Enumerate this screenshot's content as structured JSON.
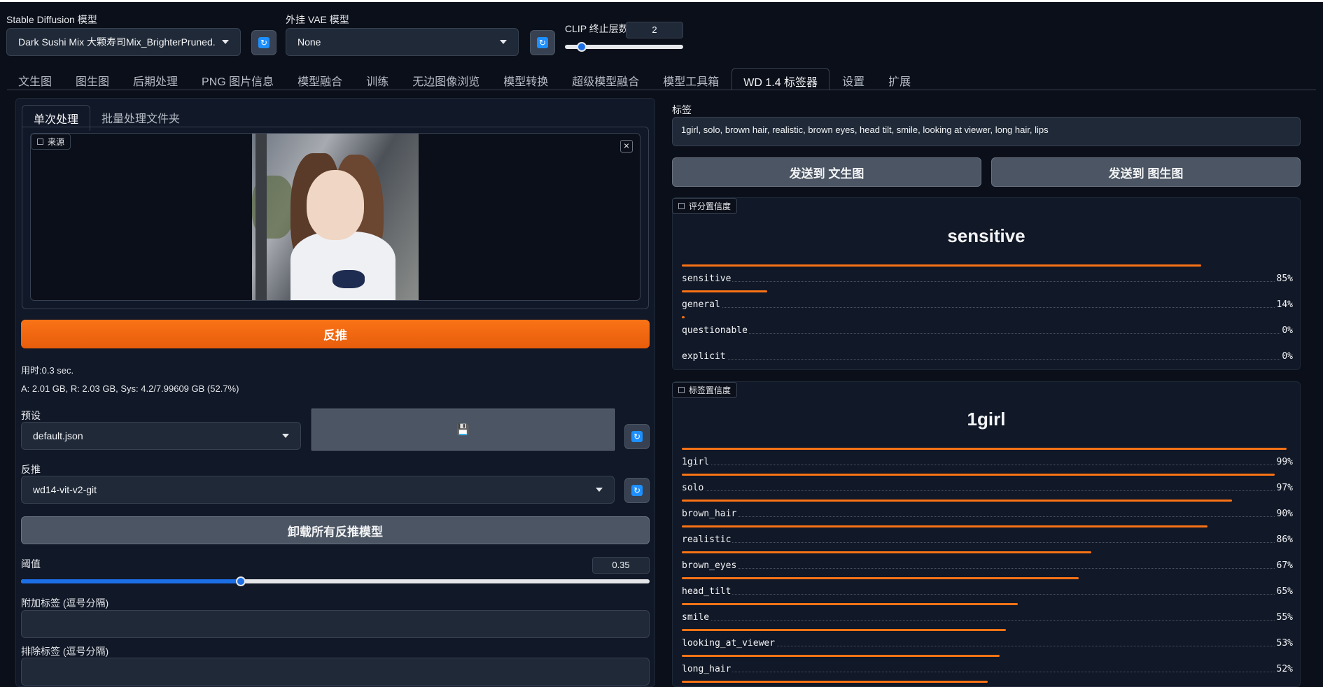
{
  "header": {
    "sd_model_label": "Stable Diffusion 模型",
    "sd_model_value": "Dark Sushi Mix 大颗寿司Mix_BrighterPruned.safetensors",
    "vae_label": "外挂 VAE 模型",
    "vae_value": "None",
    "clip_label": "CLIP 终止层数",
    "clip_value": "2",
    "clip_fraction": 0.0
  },
  "tabs": [
    "文生图",
    "图生图",
    "后期处理",
    "PNG 图片信息",
    "模型融合",
    "训练",
    "无边图像浏览",
    "模型转换",
    "超级模型融合",
    "模型工具箱",
    "WD 1.4 标签器",
    "设置",
    "扩展"
  ],
  "active_tab": "WD 1.4 标签器",
  "left": {
    "subtabs": [
      "单次处理",
      "批量处理文件夹"
    ],
    "source_label": "来源",
    "close_glyph": "×",
    "interrogate_button": "反推",
    "time_text": "用时:0.3 sec.",
    "mem_text": "A: 2.01 GB, R: 2.03 GB, Sys: 4.2/7.99609 GB (52.7%)",
    "preset_label": "预设",
    "preset_value": "default.json",
    "save_glyph": "💾",
    "interrogator_label": "反推",
    "interrogator_value": "wd14-vit-v2-git",
    "unload_button": "卸载所有反推模型",
    "threshold_label": "阈值",
    "threshold_value": "0.35",
    "threshold_fraction": 0.35,
    "additional_tags_label": "附加标签 (逗号分隔)",
    "exclude_tags_label": "排除标签 (逗号分隔)"
  },
  "right": {
    "tags_label": "标签",
    "tags_value": "1girl, solo, brown hair, realistic, brown eyes, head tilt, smile, looking at viewer, long hair, lips",
    "send_txt2img": "发送到 文生图",
    "send_img2img": "发送到 图生图",
    "rating_label": "评分置信度",
    "rating_top": "sensitive",
    "ratings": [
      {
        "name": "sensitive",
        "pct": "85%",
        "value": 0.85
      },
      {
        "name": "general",
        "pct": "14%",
        "value": 0.14
      },
      {
        "name": "questionable",
        "pct": "0%",
        "value": 0.005
      },
      {
        "name": "explicit",
        "pct": "0%",
        "value": 0.0
      }
    ],
    "tag_conf_label": "标签置信度",
    "tag_top": "1girl",
    "tags": [
      {
        "name": "1girl",
        "pct": "99%",
        "value": 0.99
      },
      {
        "name": "solo",
        "pct": "97%",
        "value": 0.97
      },
      {
        "name": "brown_hair",
        "pct": "90%",
        "value": 0.9
      },
      {
        "name": "realistic",
        "pct": "86%",
        "value": 0.86
      },
      {
        "name": "brown_eyes",
        "pct": "67%",
        "value": 0.67
      },
      {
        "name": "head_tilt",
        "pct": "65%",
        "value": 0.65
      },
      {
        "name": "smile",
        "pct": "55%",
        "value": 0.55
      },
      {
        "name": "looking_at_viewer",
        "pct": "53%",
        "value": 0.53
      },
      {
        "name": "long_hair",
        "pct": "52%",
        "value": 0.52
      }
    ],
    "next_tag_value": 0.5
  },
  "colors": {
    "accent": "#f97316",
    "slider": "#1d6fe6",
    "background": "#0b0f19"
  }
}
